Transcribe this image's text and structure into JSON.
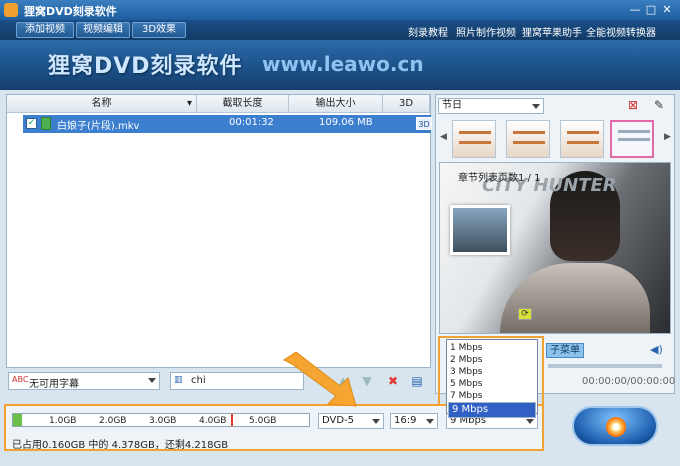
{
  "window": {
    "title": "狸窝DVD刻录软件"
  },
  "toolbar": {
    "add_video": "添加视频",
    "edit_video": "视频编辑",
    "effect_3d": "3D效果",
    "links": [
      "刻录教程",
      "照片制作视频",
      "狸窝苹果助手",
      "全能视频转换器"
    ]
  },
  "banner": {
    "product": "狸窝DVD刻录软件",
    "site": "www.leawo.cn"
  },
  "file_list": {
    "columns": [
      "名称",
      "截取长度",
      "输出大小",
      "3D"
    ],
    "rows": [
      {
        "name": "白娘子(片段).mkv",
        "length": "00:01:32",
        "size": "109.06 MB"
      }
    ]
  },
  "subtitle": {
    "value": "无可用字幕"
  },
  "audio": {
    "value": "chi"
  },
  "menu_panel": {
    "template_select": "节日",
    "preview_title": "章节列表页数1 / 1",
    "preview_logo": "CITY HUNTER",
    "submenu_label": "子菜单",
    "time": "00:00:00/00:00:00"
  },
  "bitrate_dropdown": {
    "options": [
      "1 Mbps",
      "2 Mbps",
      "3 Mbps",
      "5 Mbps",
      "7 Mbps",
      "9 Mbps"
    ],
    "selected": "9 Mbps"
  },
  "disc": {
    "ticks": [
      "1.0GB",
      "2.0GB",
      "3.0GB",
      "4.0GB",
      "5.0GB"
    ],
    "used_fraction": 0.03,
    "usage_text": "已占用0.160GB 中的 4.378GB，还剩4.218GB",
    "type": "DVD-5",
    "aspect": "16:9",
    "bitrate": "9 Mbps"
  },
  "colors": {
    "highlight": "#f2a233",
    "selection": "#3c7fcf"
  }
}
